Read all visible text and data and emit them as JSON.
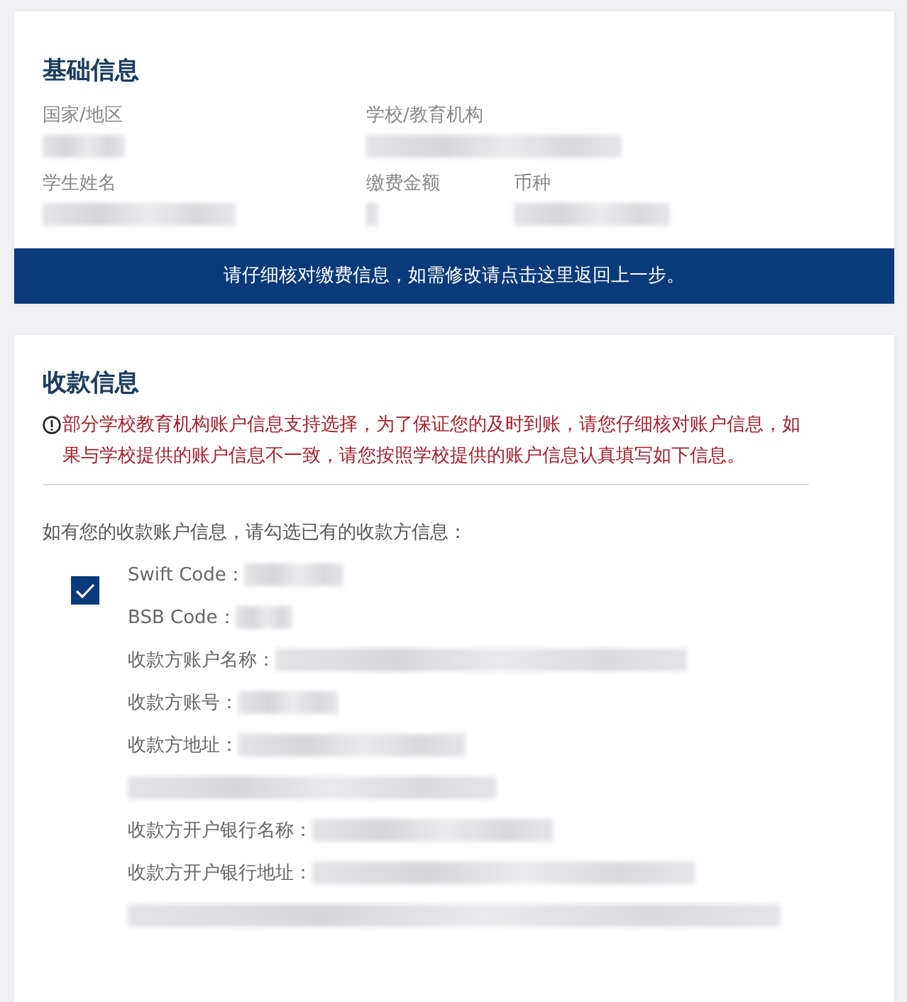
{
  "basic_info": {
    "title": "基础信息",
    "rows": [
      [
        {
          "label": "国家/地区"
        },
        {
          "label": "学校/教育机构"
        }
      ],
      [
        {
          "label": "学生姓名"
        },
        {
          "label": "缴费金额"
        },
        {
          "label": "币种"
        }
      ]
    ]
  },
  "notice": "请仔细核对缴费信息，如需修改请点击这里返回上一步。",
  "payee_info": {
    "title": "收款信息",
    "warning": "部分学校教育机构账户信息支持选择，为了保证您的及时到账，请您仔细核对账户信息，如果与学校提供的账户信息不一致，请您按照学校提供的账户信息认真填写如下信息。",
    "prompt": "如有您的收款账户信息，请勾选已有的收款方信息：",
    "account": {
      "checked": true,
      "fields": [
        {
          "label": "Swift Code："
        },
        {
          "label": "BSB Code："
        },
        {
          "label": "收款方账户名称："
        },
        {
          "label": "收款方账号："
        },
        {
          "label": "收款方地址："
        },
        {
          "label": "收款方开户银行名称："
        },
        {
          "label": "收款方开户银行地址："
        }
      ]
    }
  }
}
